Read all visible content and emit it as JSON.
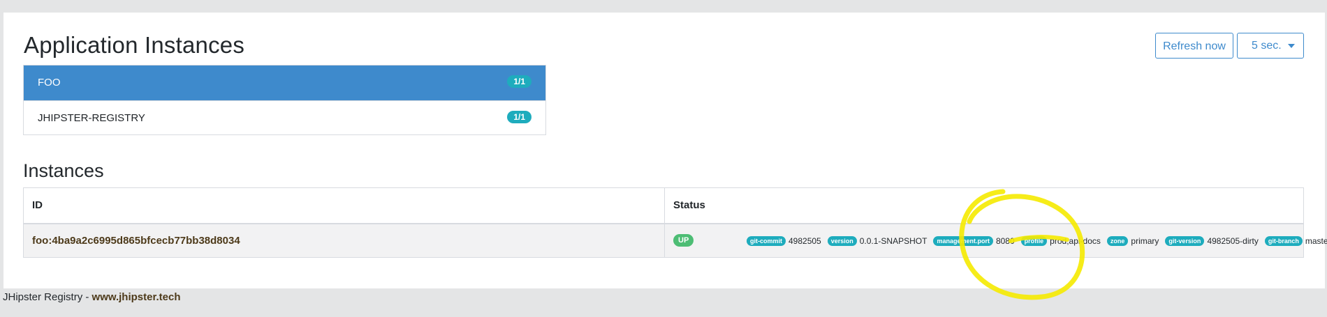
{
  "header": {
    "title": "Application Instances",
    "refresh_label": "Refresh now",
    "interval_label": "5 sec."
  },
  "apps": [
    {
      "name": "FOO",
      "count": "1/1",
      "active": true
    },
    {
      "name": "JHIPSTER-REGISTRY",
      "count": "1/1",
      "active": false
    }
  ],
  "instances": {
    "title": "Instances",
    "columns": [
      "ID",
      "Status"
    ],
    "rows": [
      {
        "id": "foo:4ba9a2c6995d865bfcecb77bb38d8034",
        "status": "UP",
        "metadata": [
          {
            "key": "git-commit",
            "value": "4982505"
          },
          {
            "key": "version",
            "value": "0.0.1-SNAPSHOT"
          },
          {
            "key": "management.port",
            "value": "8080"
          },
          {
            "key": "profile",
            "value": "prod,api-docs"
          },
          {
            "key": "zone",
            "value": "primary"
          },
          {
            "key": "git-version",
            "value": "4982505-dirty"
          },
          {
            "key": "git-branch",
            "value": "master"
          }
        ]
      }
    ]
  },
  "footer": {
    "text": "JHipster Registry - ",
    "link": "www.jhipster.tech"
  },
  "colors": {
    "primary": "#3e8acc",
    "info": "#1eacbd",
    "success": "#4dbd74",
    "annotation": "#f5ea00"
  }
}
